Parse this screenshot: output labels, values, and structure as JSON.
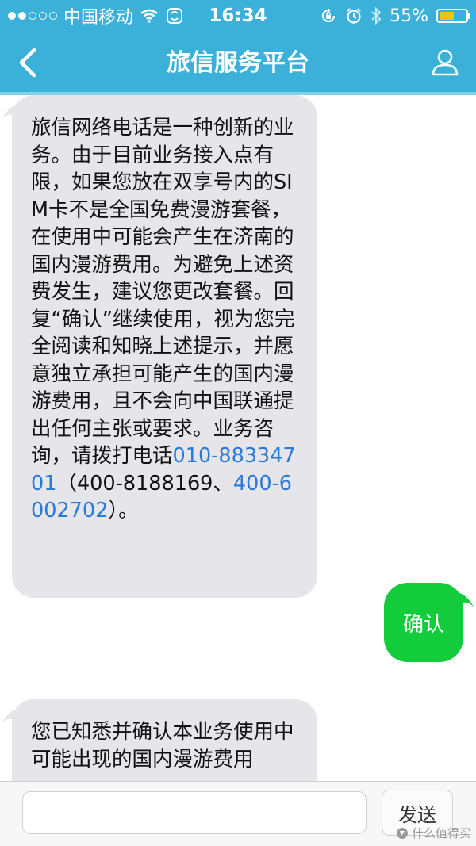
{
  "status_bar": {
    "carrier": "中国移动",
    "time": "16:34",
    "battery_percent": "55%",
    "battery_level": 0.55,
    "signal_strength": 2,
    "signal_max": 5
  },
  "nav": {
    "title": "旅信服务平台",
    "back_icon": "chevron-left-icon",
    "profile_icon": "user-icon"
  },
  "messages": [
    {
      "direction": "incoming",
      "parts": {
        "text1": "旅信网络电话是一种创新的业务。由于目前业务接入点有限，如果您放在双享号内的SIM卡不是全国免费漫游套餐，在使用中可能会产生在济南的国内漫游费用。为避免上述资费发生，建议您更改套餐。回复“确认”继续使用，视为您完全阅读和知晓上述提示，并愿意独立承担可能产生的国内漫游费用，且不会向中国联通提出任何主张或要求。业务咨询，请拨打电话",
        "link1": "010-88334701",
        "text2": "（400-8188169、",
        "link2": "400-6002702",
        "text3": "）。"
      }
    },
    {
      "direction": "outgoing",
      "text": "确认"
    },
    {
      "direction": "incoming",
      "text": "您已知悉并确认本业务使用中可能出现的国内漫游费用"
    }
  ],
  "input_bar": {
    "placeholder": "",
    "send_label": "发送"
  },
  "watermark": "什么值得买",
  "colors": {
    "header": "#3bb0d8",
    "incoming_bubble": "#e5e5ea",
    "outgoing_bubble": "#12cc3c",
    "link": "#2b7ad6",
    "battery": "#f5c400"
  }
}
